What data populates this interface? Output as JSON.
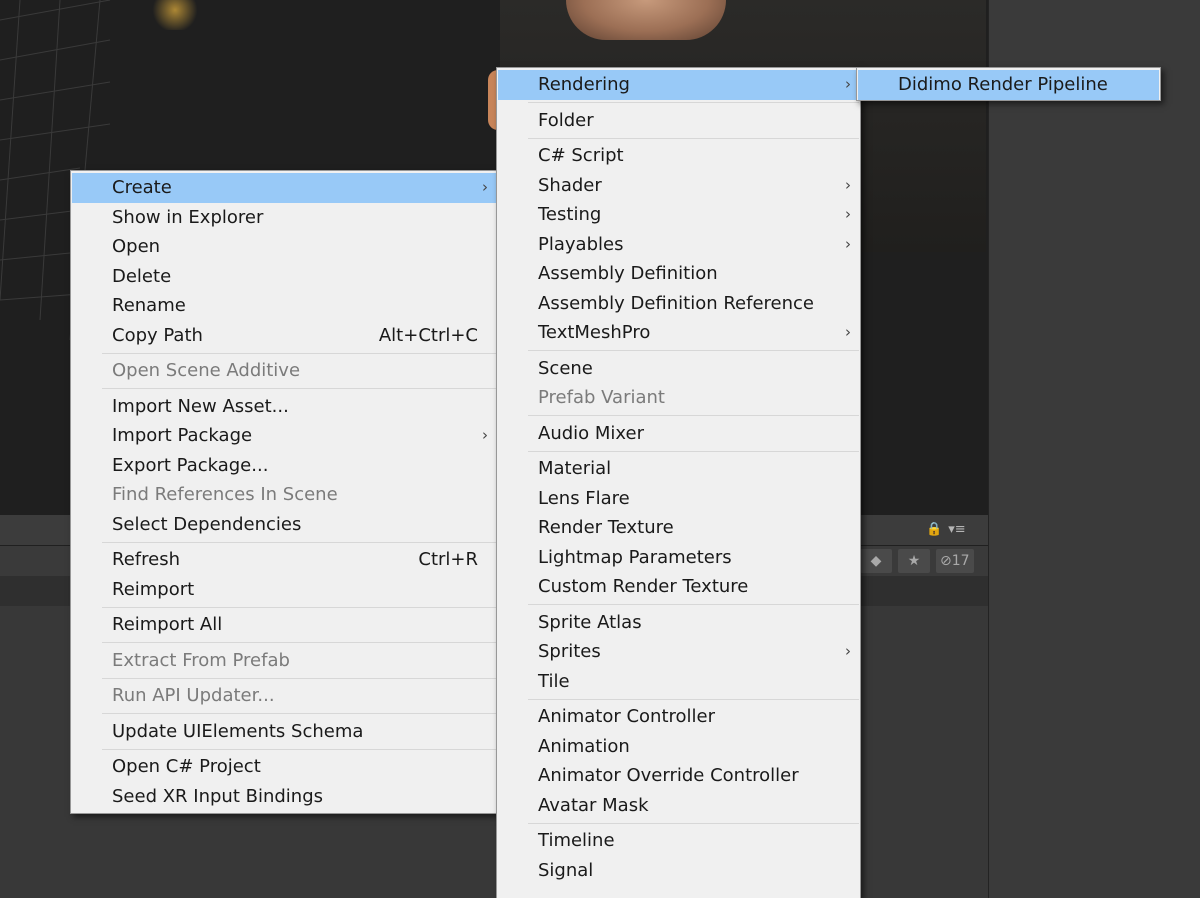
{
  "toolbar": {
    "hidden_count": "17",
    "menu_glyph": "▾≡"
  },
  "context_menu": {
    "groups": [
      [
        {
          "label": "Create",
          "submenu": true,
          "highlighted": true
        },
        {
          "label": "Show in Explorer"
        },
        {
          "label": "Open"
        },
        {
          "label": "Delete"
        },
        {
          "label": "Rename"
        },
        {
          "label": "Copy Path",
          "shortcut": "Alt+Ctrl+C"
        }
      ],
      [
        {
          "label": "Open Scene Additive",
          "disabled": true
        }
      ],
      [
        {
          "label": "Import New Asset..."
        },
        {
          "label": "Import Package",
          "submenu": true
        },
        {
          "label": "Export Package..."
        },
        {
          "label": "Find References In Scene",
          "disabled": true
        },
        {
          "label": "Select Dependencies"
        }
      ],
      [
        {
          "label": "Refresh",
          "shortcut": "Ctrl+R"
        },
        {
          "label": "Reimport"
        }
      ],
      [
        {
          "label": "Reimport All"
        }
      ],
      [
        {
          "label": "Extract From Prefab",
          "disabled": true
        }
      ],
      [
        {
          "label": "Run API Updater...",
          "disabled": true
        }
      ],
      [
        {
          "label": "Update UIElements Schema"
        }
      ],
      [
        {
          "label": "Open C# Project"
        },
        {
          "label": "Seed XR Input Bindings"
        }
      ]
    ]
  },
  "create_menu": {
    "groups": [
      [
        {
          "label": "Rendering",
          "submenu": true,
          "highlighted": true
        }
      ],
      [
        {
          "label": "Folder"
        }
      ],
      [
        {
          "label": "C# Script"
        },
        {
          "label": "Shader",
          "submenu": true
        },
        {
          "label": "Testing",
          "submenu": true
        },
        {
          "label": "Playables",
          "submenu": true
        },
        {
          "label": "Assembly Definition"
        },
        {
          "label": "Assembly Definition Reference"
        },
        {
          "label": "TextMeshPro",
          "submenu": true
        }
      ],
      [
        {
          "label": "Scene"
        },
        {
          "label": "Prefab Variant",
          "disabled": true
        }
      ],
      [
        {
          "label": "Audio Mixer"
        }
      ],
      [
        {
          "label": "Material"
        },
        {
          "label": "Lens Flare"
        },
        {
          "label": "Render Texture"
        },
        {
          "label": "Lightmap Parameters"
        },
        {
          "label": "Custom Render Texture"
        }
      ],
      [
        {
          "label": "Sprite Atlas"
        },
        {
          "label": "Sprites",
          "submenu": true
        },
        {
          "label": "Tile"
        }
      ],
      [
        {
          "label": "Animator Controller"
        },
        {
          "label": "Animation"
        },
        {
          "label": "Animator Override Controller"
        },
        {
          "label": "Avatar Mask"
        }
      ],
      [
        {
          "label": "Timeline"
        },
        {
          "label": "Signal"
        }
      ]
    ]
  },
  "rendering_menu": {
    "items": [
      {
        "label": "Didimo Render Pipeline",
        "highlighted": true
      }
    ]
  },
  "colors": {
    "menu_bg": "#f0f0f0",
    "highlight": "#98c9f7",
    "disabled_text": "#7b7b7b",
    "editor_bg": "#383838"
  }
}
